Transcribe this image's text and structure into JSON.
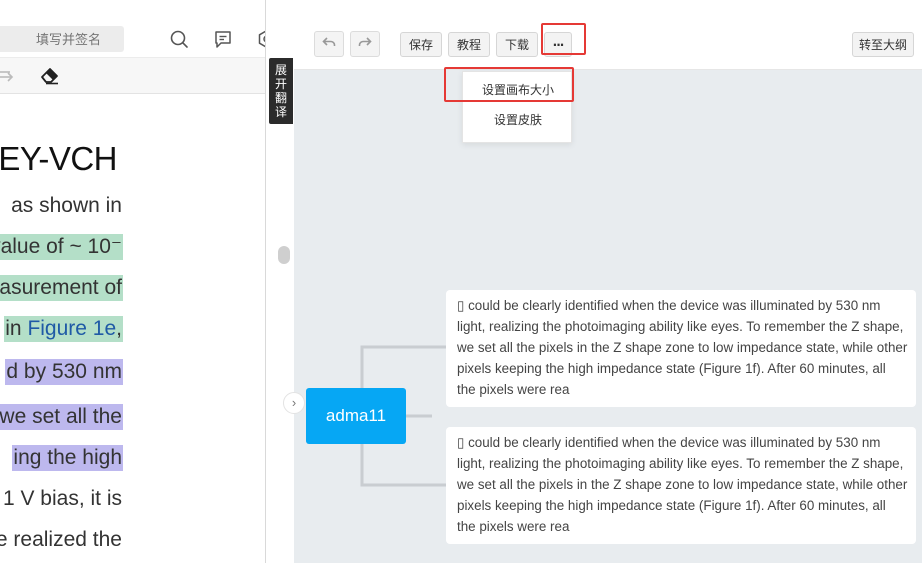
{
  "left_panel": {
    "signature_placeholder": "填写并签名",
    "icons": [
      "search-icon",
      "comment-icon",
      "settings-icon",
      "redo-icon",
      "eraser-icon"
    ],
    "heading": "EY-VCH",
    "lines": [
      {
        "text": "as shown in",
        "highlight": "none"
      },
      {
        "text": "value of ~ 10⁻",
        "highlight": "green"
      },
      {
        "text": "asurement of",
        "highlight": "green"
      },
      {
        "pre": "in ",
        "link": "Figure 1e",
        "post": ",",
        "highlight": "green"
      },
      {
        "text": "d by 530 nm",
        "highlight": "purple"
      },
      {
        "text": "we set all the",
        "highlight": "purple"
      },
      {
        "text": "ing the high",
        "highlight": "purple"
      },
      {
        "text": "1 V bias, it is",
        "highlight": "none"
      },
      {
        "text": "e realized the",
        "highlight": "none"
      }
    ]
  },
  "translate_tab": {
    "label": "展开翻译"
  },
  "mindmap": {
    "toolbar": {
      "undo_icon": "undo-icon",
      "redo_icon": "redo-icon",
      "save": "保存",
      "tutorial": "教程",
      "download": "下载",
      "more": "···",
      "outline": "转至大纲"
    },
    "more_menu": {
      "items": [
        "设置画布大小",
        "设置皮肤"
      ]
    },
    "root": {
      "label": "adma11"
    },
    "children": [
      "▯ could be clearly identified when the device was illuminated by 530 nm light, realizing the photoimaging ability like eyes. To remember the Z shape, we set all the pixels in the Z shape zone to low impedance state, while other pixels keeping the high impedance state (Figure 1f). After 60 minutes, all the pixels were rea",
      "▯ could be clearly identified when the device was illuminated by 530 nm light, realizing the photoimaging ability like eyes. To remember the Z shape, we set all the pixels in the Z shape zone to low impedance state, while other pixels keeping the high impedance state (Figure 1f). After 60 minutes, all the pixels were rea"
    ]
  },
  "colors": {
    "root_node": "#06a7f4",
    "highlight_green": "#b4dfc8",
    "highlight_purple": "#bdb8ee",
    "canvas_background": "#e8ecef",
    "annotation_red": "#e53935"
  }
}
